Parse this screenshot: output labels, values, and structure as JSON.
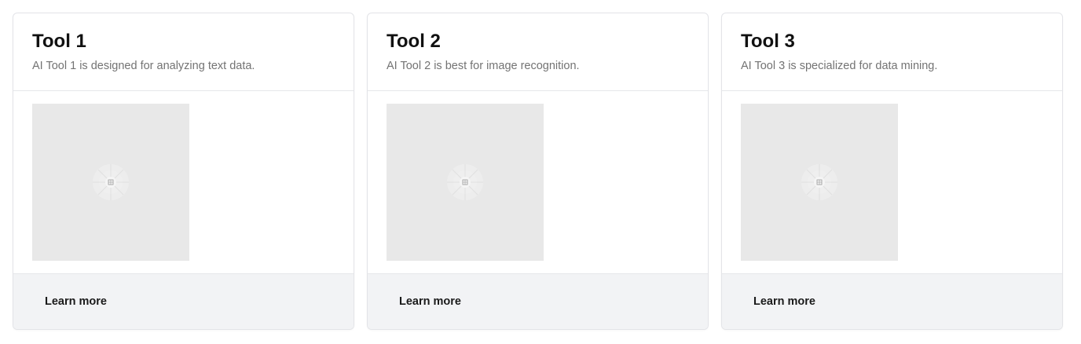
{
  "cards": [
    {
      "title": "Tool 1",
      "description": "AI Tool 1 is designed for analyzing text data.",
      "button": "Learn more"
    },
    {
      "title": "Tool 2",
      "description": "AI Tool 2 is best for image recognition.",
      "button": "Learn more"
    },
    {
      "title": "Tool 3",
      "description": "AI Tool 3 is specialized for data mining.",
      "button": "Learn more"
    }
  ],
  "colors": {
    "placeholder_bg": "#e8e8e8",
    "footer_bg": "#f2f3f5",
    "border": "#e3e4e8"
  },
  "icons": {
    "placeholder": "image-placeholder-icon"
  }
}
